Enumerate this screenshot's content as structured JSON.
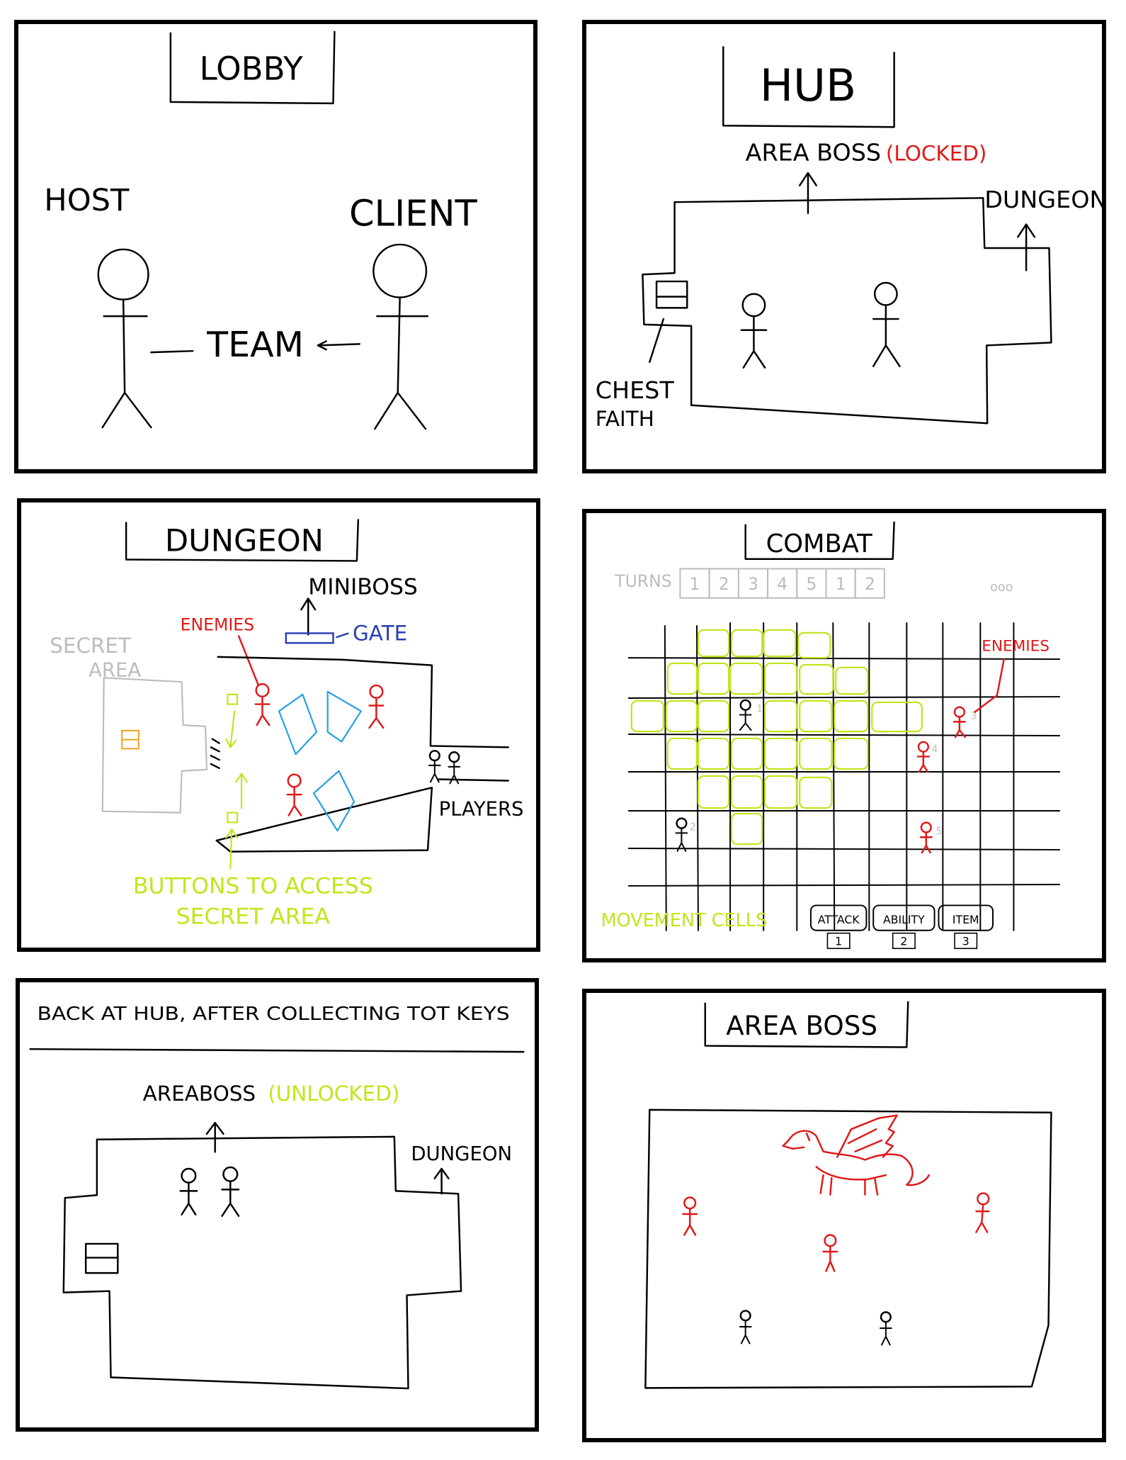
{
  "colors": {
    "ink": "#000000",
    "enemy_red": "#e01818",
    "button_green": "#bfe61a",
    "gate_blue": "#2b3fb0",
    "secret_gray": "#bcbcbc",
    "chest_orange": "#f0a020"
  },
  "panels": {
    "lobby": {
      "title": "LOBBY",
      "host": "HOST",
      "client": "CLIENT",
      "team": "TEAM"
    },
    "hub": {
      "title": "HUB",
      "area_boss": "AREA BOSS",
      "locked": "(LOCKED)",
      "dungeon": "DUNGEON",
      "chest": "CHEST",
      "faith": "FAITH"
    },
    "dungeon": {
      "title": "DUNGEON",
      "miniboss": "MINIBOSS",
      "gate": "GATE",
      "enemies": "ENEMIES",
      "secret": "SECRET",
      "area": "AREA",
      "players": "PLAYERS",
      "buttons_line1": "BUTTONS TO ACCESS",
      "buttons_line2": "SECRET AREA"
    },
    "combat": {
      "title": "COMBAT",
      "turns_label": "TURNS",
      "turns": [
        "1",
        "2",
        "3",
        "4",
        "5",
        "1",
        "2"
      ],
      "turns_more": "ooo",
      "enemies": "ENEMIES",
      "unit_numbers": [
        "1",
        "2",
        "3",
        "4",
        "5"
      ],
      "movement_cells": "MOVEMENT CELLS",
      "actions": [
        {
          "label": "ATTACK",
          "key": "1"
        },
        {
          "label": "ABILITY",
          "key": "2"
        },
        {
          "label": "ITEM",
          "key": "3"
        }
      ]
    },
    "back_hub": {
      "heading": "BACK AT HUB, AFTER COLLECTING TOT KEYS",
      "area_boss": "AREABOSS",
      "unlocked": "(UNLOCKED)",
      "dungeon": "DUNGEON"
    },
    "area_boss": {
      "title": "AREA BOSS"
    }
  }
}
